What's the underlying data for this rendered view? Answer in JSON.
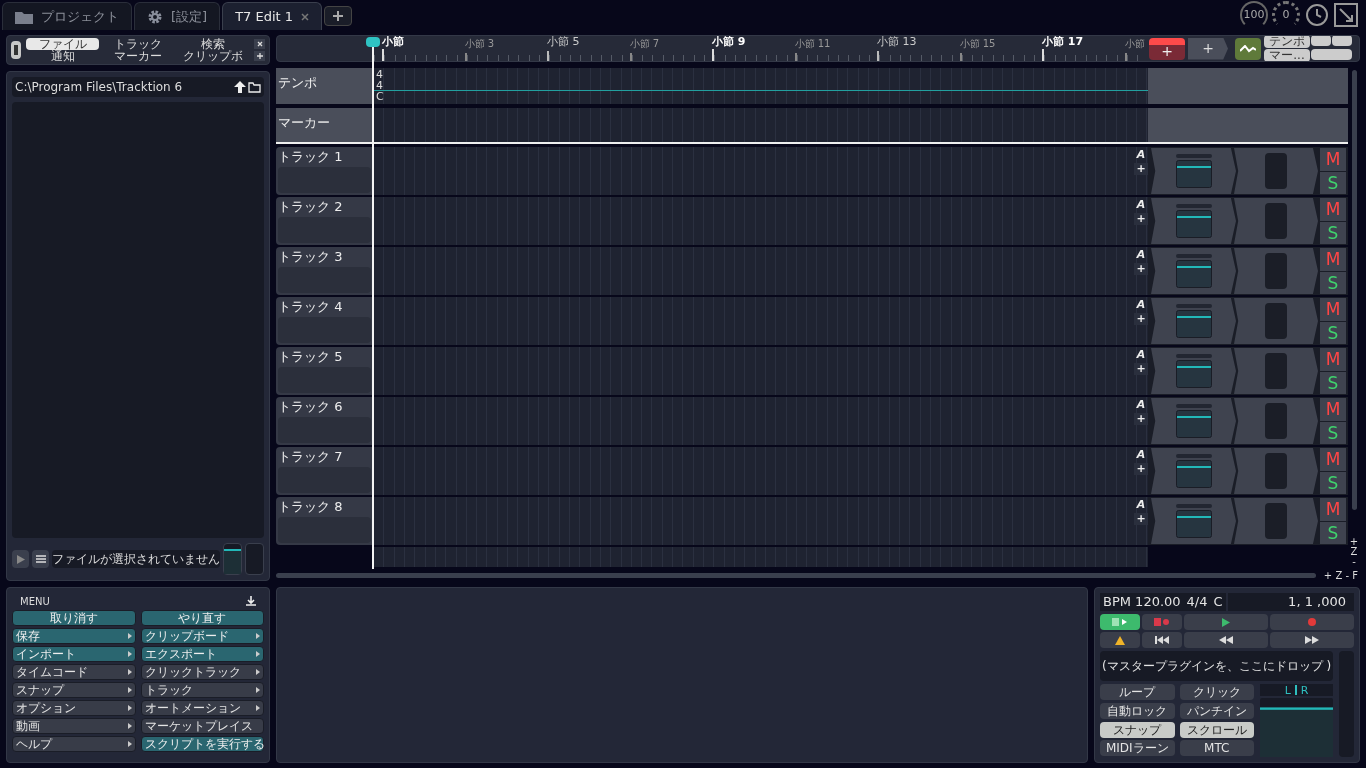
{
  "tabs": [
    {
      "label": "プロジェクト",
      "kind": "folder",
      "selected": false
    },
    {
      "label": "[設定]",
      "kind": "gear",
      "selected": false
    },
    {
      "label": "T7 Edit 1",
      "kind": "edit",
      "selected": true
    }
  ],
  "gauges": [
    {
      "kind": "cpu",
      "value": "100"
    },
    {
      "kind": "dial",
      "value": "0"
    }
  ],
  "browser": {
    "tabs": [
      {
        "label": "ファイル",
        "selected": true
      },
      {
        "label": "トラック",
        "selected": false
      },
      {
        "label": "検索",
        "selected": false
      },
      {
        "label": "通知",
        "selected": false
      },
      {
        "label": "マーカー",
        "selected": false
      },
      {
        "label": "クリップボ",
        "selected": false
      }
    ],
    "path": "C:\\Program Files\\Tracktion 6",
    "status": "ファイルが選択されていません",
    "preview_fader": {
      "level": 0.85
    }
  },
  "ruler": [
    {
      "label": "小節",
      "kind": "major"
    },
    {
      "label": "小節 3",
      "kind": "minor"
    },
    {
      "label": "小節 5",
      "kind": "mid"
    },
    {
      "label": "小節 7",
      "kind": "minor"
    },
    {
      "label": "小節 9",
      "kind": "major"
    },
    {
      "label": "小節 11",
      "kind": "minor"
    },
    {
      "label": "小節 13",
      "kind": "mid"
    },
    {
      "label": "小節 15",
      "kind": "minor"
    },
    {
      "label": "小節 17",
      "kind": "major"
    },
    {
      "label": "小節",
      "kind": "minor"
    }
  ],
  "toolbar": {
    "add_buttons": [
      "+",
      "+"
    ],
    "view_buttons": [
      "テンポ",
      "マー..."
    ]
  },
  "tempo_track": {
    "name": "テンポ",
    "values": [
      "4",
      "4",
      "C"
    ]
  },
  "marker_track": {
    "name": "マーカー"
  },
  "tracks": [
    {
      "name": "トラック 1",
      "auto": "A",
      "add": "+",
      "mute": "M",
      "solo": "S"
    },
    {
      "name": "トラック 2",
      "auto": "A",
      "add": "+",
      "mute": "M",
      "solo": "S"
    },
    {
      "name": "トラック 3",
      "auto": "A",
      "add": "+",
      "mute": "M",
      "solo": "S"
    },
    {
      "name": "トラック 4",
      "auto": "A",
      "add": "+",
      "mute": "M",
      "solo": "S"
    },
    {
      "name": "トラック 5",
      "auto": "A",
      "add": "+",
      "mute": "M",
      "solo": "S"
    },
    {
      "name": "トラック 6",
      "auto": "A",
      "add": "+",
      "mute": "M",
      "solo": "S"
    },
    {
      "name": "トラック 7",
      "auto": "A",
      "add": "+",
      "mute": "M",
      "solo": "S"
    },
    {
      "name": "トラック 8",
      "auto": "A",
      "add": "+",
      "mute": "M",
      "solo": "S"
    }
  ],
  "zoom_vertical": [
    "+",
    "Z",
    "-"
  ],
  "zoom_horizontal": "+ Z - F",
  "menu": {
    "title": "MENU",
    "items": [
      {
        "label": "取り消す",
        "highlighted": true,
        "kind": "action"
      },
      {
        "label": "やり直す",
        "highlighted": true,
        "kind": "action"
      },
      {
        "label": "保存",
        "highlighted": true,
        "kind": "submenu"
      },
      {
        "label": "クリップボード",
        "highlighted": true,
        "kind": "submenu"
      },
      {
        "label": "インポート",
        "highlighted": true,
        "kind": "submenu"
      },
      {
        "label": "エクスポート",
        "highlighted": true,
        "kind": "submenu"
      },
      {
        "label": "タイムコード",
        "highlighted": false,
        "kind": "submenu"
      },
      {
        "label": "クリックトラック",
        "highlighted": false,
        "kind": "submenu"
      },
      {
        "label": "スナップ",
        "highlighted": false,
        "kind": "submenu"
      },
      {
        "label": "トラック",
        "highlighted": false,
        "kind": "submenu"
      },
      {
        "label": "オプション",
        "highlighted": false,
        "kind": "submenu"
      },
      {
        "label": "オートメーション",
        "highlighted": false,
        "kind": "submenu"
      },
      {
        "label": "動画",
        "highlighted": false,
        "kind": "submenu"
      },
      {
        "label": "マーケットプレイス",
        "highlighted": false,
        "kind": "command"
      },
      {
        "label": "ヘルプ",
        "highlighted": false,
        "kind": "submenu"
      },
      {
        "label": "スクリプトを実行する",
        "highlighted": true,
        "kind": "command"
      }
    ]
  },
  "transport": {
    "bpm": "BPM 120.00",
    "signature": "4/4",
    "key": "C",
    "position": "1, 1 ,000",
    "drop_hint": "(マスタープラグインを、ここにドロップ )",
    "toggles": [
      {
        "label": "ループ",
        "on": false
      },
      {
        "label": "クリック",
        "on": false
      },
      {
        "label": "自動ロック",
        "on": false
      },
      {
        "label": "パンチイン",
        "on": false
      },
      {
        "label": "スナップ",
        "on": true
      },
      {
        "label": "スクロール",
        "on": true
      },
      {
        "label": "MIDIラーン",
        "on": false
      },
      {
        "label": "MTC",
        "on": false
      }
    ],
    "channels": [
      "L",
      "R"
    ]
  }
}
